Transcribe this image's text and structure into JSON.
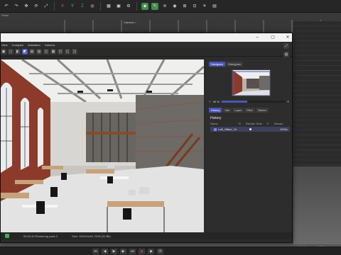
{
  "app": {
    "panel_label": "Panel",
    "camera_label": "Camera ○",
    "grid_spacing": "Grid Spacing : 10000 cm"
  },
  "toolbar_icons": [
    "undo-icon",
    "redo-icon",
    "move-icon",
    "rotate-icon",
    "scale-icon",
    "x-axis-icon",
    "y-axis-icon",
    "z-axis-icon",
    "world-icon",
    "render-region-icon",
    "render-view-icon",
    "render-settings-icon",
    "cube-icon",
    "pen-icon",
    "hair-icon",
    "shader-icon",
    "snap-icon",
    "lock-icon",
    "light-icon",
    "camera-icon"
  ],
  "toolbar_glyphs": [
    "↶",
    "↷",
    "✥",
    "⟳",
    "⤢",
    "X",
    "Y",
    "Z",
    "◎",
    "▦",
    "▣",
    "⚙",
    "◆",
    "✎",
    "≋",
    "◉",
    "⊞",
    "⊡",
    "☀",
    "▤"
  ],
  "picture_viewer": {
    "title": "",
    "menu": [
      "View",
      "Compare",
      "Animation",
      "Camera"
    ],
    "icons": [
      "▣",
      "▢",
      "◧",
      "◩",
      "▤",
      "▥",
      "◫",
      "▦",
      "◰",
      "◱",
      "◲"
    ],
    "active_icon_index": 3
  },
  "side_panel": {
    "nav_tabs": [
      "Navigator",
      "Histogram"
    ],
    "zoom_label": "40 %",
    "zoom_fraction": 0.4,
    "history_tabs": [
      "History",
      "Info",
      "Layer",
      "Filter",
      "Stereo"
    ],
    "history_heading": "History",
    "history_columns": [
      "Name",
      "R",
      "Render Time",
      "F",
      "Resolu"
    ],
    "history_row": {
      "name": "Loft_Office_19",
      "resolution": "1920x"
    }
  },
  "status_bar": {
    "text1": "00:00:42 Rendering pass 2",
    "text2": "Size: 1920x1440, RGB (32 Bit)"
  },
  "colors": {
    "accent": "#4a56b8",
    "titlebar": "#f2f2f2",
    "panel": "#2d2d2d"
  }
}
